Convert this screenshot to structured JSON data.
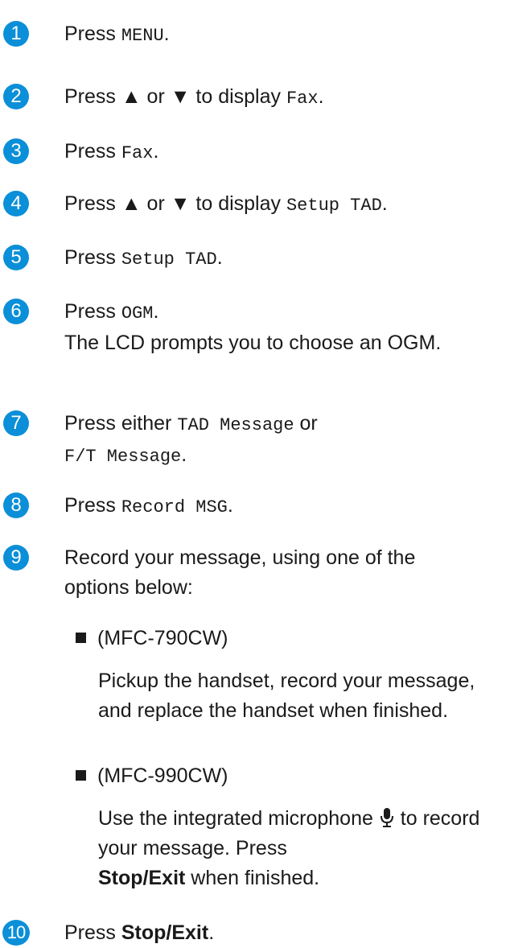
{
  "accent_color": "#0a8fd8",
  "steps": [
    {
      "num": "1",
      "pre": "Press ",
      "code": "MENU",
      "post": "."
    },
    {
      "num": "2",
      "pre": "Press ▲ or ▼ to display ",
      "code": "Fax",
      "post": "."
    },
    {
      "num": "3",
      "pre": "Press ",
      "code": "Fax",
      "post": "."
    },
    {
      "num": "4",
      "pre": "Press ▲ or ▼ to display ",
      "code": "Setup TAD",
      "post": "."
    },
    {
      "num": "5",
      "pre": "Press ",
      "code": "Setup TAD",
      "post": "."
    },
    {
      "num": "6",
      "pre": "Press ",
      "code": "OGM",
      "post": ".",
      "note": "The LCD prompts you to choose an OGM."
    },
    {
      "num": "7",
      "pre": "Press either ",
      "code": "TAD Message",
      "mid": " or",
      "code2": "F/T Message",
      "post": "."
    },
    {
      "num": "8",
      "pre": "Press ",
      "code": "Record MSG",
      "post": "."
    },
    {
      "num": "9",
      "text": "Record your message, using one of the options below:"
    },
    {
      "num": "10",
      "pre": "Press ",
      "bold": "Stop/Exit",
      "post": "."
    }
  ],
  "options": [
    {
      "model": "(MFC-790CW)",
      "text": "Pickup the handset, record your message, and replace the handset when finished."
    },
    {
      "model": "(MFC-990CW)",
      "text1": "Use the integrated microphone",
      "text2": "to record your message. Press",
      "bold": "Stop/Exit",
      "text3": " when finished."
    }
  ]
}
